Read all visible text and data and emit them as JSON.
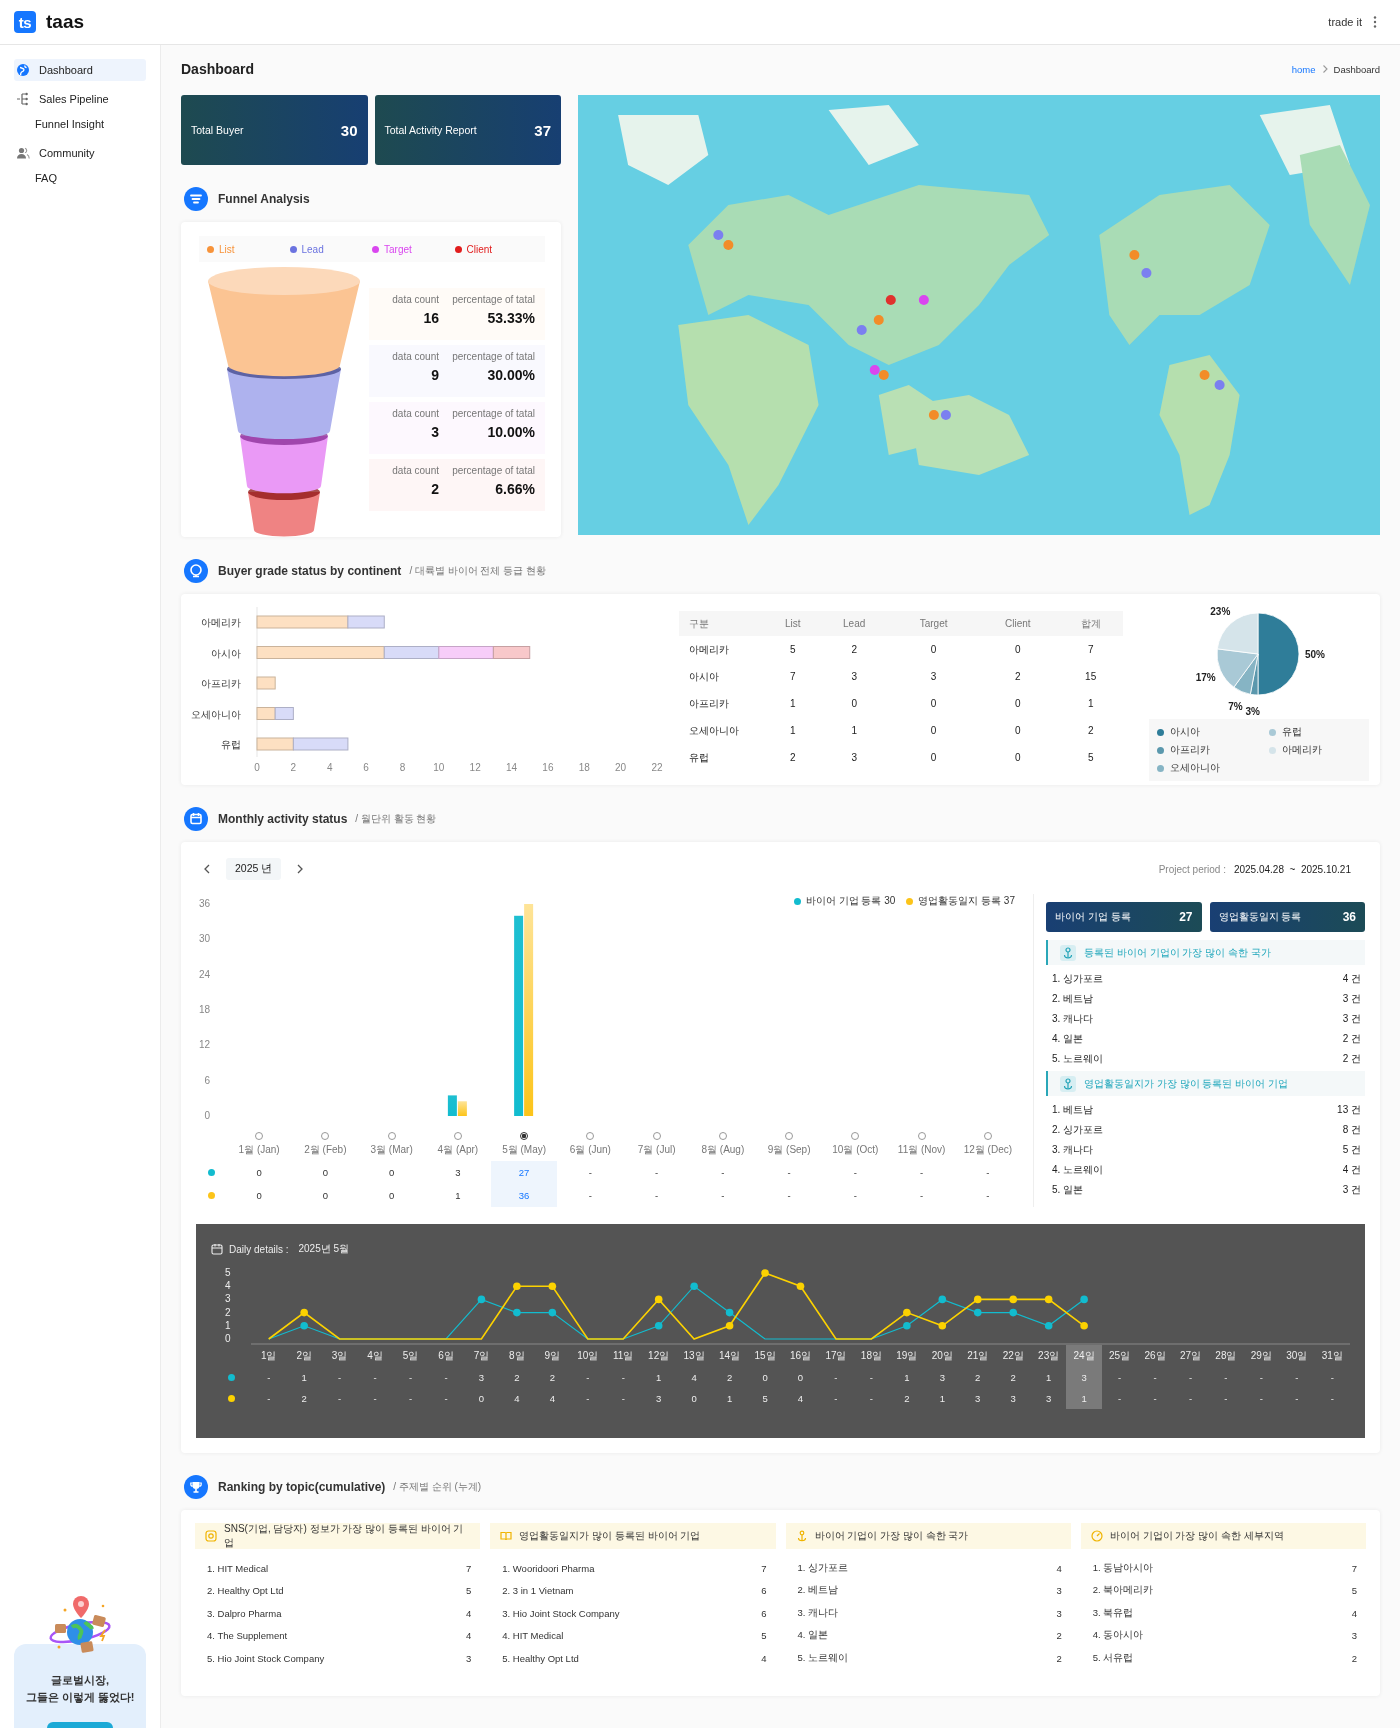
{
  "header": {
    "logo_mark": "ts",
    "brand": "taas",
    "user": "trade it"
  },
  "sidebar": {
    "items": [
      {
        "label": "Dashboard",
        "selected": true
      },
      {
        "label": "Sales Pipeline",
        "selected": false,
        "children": [
          {
            "label": "Funnel Insight",
            "selected": false
          }
        ]
      },
      {
        "label": "Community",
        "selected": false,
        "children": [
          {
            "label": "FAQ",
            "selected": false
          }
        ]
      }
    ],
    "promo": {
      "text": "글로벌시장,\n그들은 이렇게 뚫었다!"
    }
  },
  "page": {
    "title": "Dashboard",
    "breadcrumb": [
      "home",
      "Dashboard"
    ]
  },
  "stats": [
    {
      "label": "Total Buyer",
      "value": "30"
    },
    {
      "label": "Total Activity Report",
      "value": "37"
    }
  ],
  "funnel": {
    "title": "Funnel Analysis",
    "stages": [
      {
        "label": "List",
        "color": "#f7933a",
        "count_label": "data count",
        "count": "16",
        "percent_label": "percentage of tatal",
        "percent": "53.33%"
      },
      {
        "label": "Lead",
        "color": "#6b73e0",
        "count_label": "data count",
        "count": "9",
        "percent_label": "percentage of tatal",
        "percent": "30.00%"
      },
      {
        "label": "Target",
        "color": "#d946ef",
        "count_label": "data count",
        "count": "3",
        "percent_label": "percentage of tatal",
        "percent": "10.00%"
      },
      {
        "label": "Client",
        "color": "#e11d1d",
        "count_label": "data count",
        "count": "2",
        "percent_label": "percentage of tatal",
        "percent": "6.66%"
      }
    ]
  },
  "buyer_grade": {
    "title": "Buyer grade status by continent",
    "subtitle": "/ 대륙별 바이어 전체 등급 현황",
    "chart_data": {
      "type": "bar",
      "orientation": "horizontal",
      "stacked": true,
      "categories": [
        "아메리카",
        "아시아",
        "아프리카",
        "오세아니아",
        "유럽"
      ],
      "series": [
        {
          "color": "#fde0c2",
          "values": [
            5,
            7,
            1,
            1,
            2
          ]
        },
        {
          "color": "#d8dbf8",
          "values": [
            2,
            3,
            0,
            1,
            3
          ]
        },
        {
          "color": "#f7cdf9",
          "values": [
            0,
            3,
            0,
            0,
            0
          ]
        },
        {
          "color": "#f8c8ca",
          "values": [
            0,
            2,
            0,
            0,
            0
          ]
        }
      ],
      "xlim": [
        0,
        22
      ],
      "xticks": [
        0,
        2,
        4,
        6,
        8,
        10,
        12,
        14,
        16,
        18,
        20,
        22
      ]
    },
    "table": {
      "columns": [
        "구분",
        "List",
        "Lead",
        "Target",
        "Client",
        "합계"
      ],
      "rows": [
        [
          "아메리카",
          "5",
          "2",
          "0",
          "0",
          "7"
        ],
        [
          "아시아",
          "7",
          "3",
          "3",
          "2",
          "15"
        ],
        [
          "아프리카",
          "1",
          "0",
          "0",
          "0",
          "1"
        ],
        [
          "오세아니아",
          "1",
          "1",
          "0",
          "0",
          "2"
        ],
        [
          "유럽",
          "2",
          "3",
          "0",
          "0",
          "5"
        ]
      ]
    },
    "pie": {
      "chart_data": {
        "type": "pie",
        "categories": [
          "아시아",
          "아프리카",
          "오세아니아",
          "유럽",
          "아메리카"
        ],
        "values": [
          50,
          3,
          7,
          17,
          23
        ],
        "value_labels": [
          "50%",
          "3%",
          "7%",
          "17%",
          "23%"
        ]
      },
      "legend": [
        {
          "color": "#2f7d99"
        },
        {
          "color": "#5b98ad"
        },
        {
          "color": "#86b4c4"
        },
        {
          "color": "#a9c9d6"
        },
        {
          "color": "#d5e4ea"
        }
      ]
    }
  },
  "monthly": {
    "title": "Monthly activity status",
    "subtitle": "/ 월단위 활동 현황",
    "year": "2025 년",
    "period": {
      "label": "Project period :",
      "value": "2025.04.28  ~  2025.10.21"
    },
    "chart_data": {
      "type": "bar",
      "categories": [
        "1월 (Jan)",
        "2월 (Feb)",
        "3월 (Mar)",
        "4월 (Apr)",
        "5월 (May)",
        "6월 (Jun)",
        "7월 (Jul)",
        "8월 (Aug)",
        "9월 (Sep)",
        "10월 (Oct)",
        "11월 (Nov)",
        "12월 (Dec)"
      ],
      "series": [
        {
          "name": "바이어 기업 등록 30",
          "color": "#12bccf",
          "values": [
            0,
            0,
            0,
            3.5,
            34,
            null,
            null,
            null,
            null,
            null,
            null,
            null
          ]
        },
        {
          "name": "영업활동일지 등록 37",
          "color": "#fcc419",
          "values": [
            0,
            0,
            0,
            2.5,
            36,
            null,
            null,
            null,
            null,
            null,
            null,
            null
          ]
        }
      ],
      "ylim": [
        0,
        36
      ],
      "yticks": [
        0,
        6,
        12,
        18,
        24,
        30,
        36
      ],
      "legend": "upper right"
    },
    "months": [
      {
        "selected": false
      },
      {
        "selected": false
      },
      {
        "selected": false
      },
      {
        "selected": false
      },
      {
        "selected": true
      },
      {
        "selected": false
      },
      {
        "selected": false
      },
      {
        "selected": false
      },
      {
        "selected": false
      },
      {
        "selected": false
      },
      {
        "selected": false
      },
      {
        "selected": false
      }
    ],
    "table_rows": [
      [
        "0",
        "0",
        "0",
        "3",
        "27",
        "-",
        "-",
        "-",
        "-",
        "-",
        "-",
        "-"
      ],
      [
        "0",
        "0",
        "0",
        "1",
        "36",
        "-",
        "-",
        "-",
        "-",
        "-",
        "-",
        "-"
      ]
    ],
    "summary": [
      {
        "label": "바이어 기업 등록",
        "value": "27"
      },
      {
        "label": "영업활동일지 등록",
        "value": "36"
      }
    ],
    "lists": [
      {
        "title": "등록된 바이어 기업이 가장 많이 속한 국가",
        "items": [
          {
            "name": "1. 싱가포르",
            "value": "4 건"
          },
          {
            "name": "2. 베트남",
            "value": "3 건"
          },
          {
            "name": "3. 캐나다",
            "value": "3 건"
          },
          {
            "name": "4. 일본",
            "value": "2 건"
          },
          {
            "name": "5. 노르웨이",
            "value": "2 건"
          }
        ]
      },
      {
        "title": "영업활동일지가 가장 많이 등록된 바이어 기업",
        "items": [
          {
            "name": "1. 베트남",
            "value": "13 건"
          },
          {
            "name": "2. 싱가포르",
            "value": "8 건"
          },
          {
            "name": "3. 캐나다",
            "value": "5 건"
          },
          {
            "name": "4. 노르웨이",
            "value": "4 건"
          },
          {
            "name": "5. 일본",
            "value": "3 건"
          }
        ]
      }
    ],
    "daily": {
      "title": "Daily details :",
      "month": "2025년 5월",
      "chart_data": {
        "type": "line",
        "categories": [
          "1일",
          "2일",
          "3일",
          "4일",
          "5일",
          "6일",
          "7일",
          "8일",
          "9일",
          "10일",
          "11일",
          "12일",
          "13일",
          "14일",
          "15일",
          "16일",
          "17일",
          "18일",
          "19일",
          "20일",
          "21일",
          "22일",
          "23일",
          "24일",
          "25일",
          "26일",
          "27일",
          "28일",
          "29일",
          "30일",
          "31일"
        ],
        "series": [
          {
            "color": "#12bccf",
            "values": [
              0,
              1,
              0,
              0,
              0,
              0,
              3,
              2,
              2,
              0,
              0,
              1,
              4,
              2,
              0,
              0,
              0,
              0,
              1,
              3,
              2,
              2,
              1,
              3,
              null,
              null,
              null,
              null,
              null,
              null,
              null
            ]
          },
          {
            "color": "#fcd200",
            "values": [
              0,
              2,
              0,
              0,
              0,
              0,
              0,
              4,
              4,
              0,
              0,
              3,
              0,
              1,
              5,
              4,
              0,
              0,
              2,
              1,
              3,
              3,
              3,
              1,
              null,
              null,
              null,
              null,
              null,
              null,
              null
            ]
          }
        ],
        "ylim": [
          0,
          5
        ],
        "yticks": [
          0,
          1,
          2,
          3,
          4,
          5
        ]
      },
      "days": [
        {
          "selected": false
        },
        {
          "selected": false
        },
        {
          "selected": false
        },
        {
          "selected": false
        },
        {
          "selected": false
        },
        {
          "selected": false
        },
        {
          "selected": false
        },
        {
          "selected": false
        },
        {
          "selected": false
        },
        {
          "selected": false
        },
        {
          "selected": false
        },
        {
          "selected": false
        },
        {
          "selected": false
        },
        {
          "selected": false
        },
        {
          "selected": false
        },
        {
          "selected": false
        },
        {
          "selected": false
        },
        {
          "selected": false
        },
        {
          "selected": false
        },
        {
          "selected": false
        },
        {
          "selected": false
        },
        {
          "selected": false
        },
        {
          "selected": false
        },
        {
          "selected": true
        },
        {
          "selected": false
        },
        {
          "selected": false
        },
        {
          "selected": false
        },
        {
          "selected": false
        },
        {
          "selected": false
        },
        {
          "selected": false
        },
        {
          "selected": false
        }
      ],
      "rows": [
        [
          "-",
          "1",
          "-",
          "-",
          "-",
          "-",
          "3",
          "2",
          "2",
          "-",
          "-",
          "1",
          "4",
          "2",
          "0",
          "0",
          "-",
          "-",
          "1",
          "3",
          "2",
          "2",
          "1",
          "3",
          "-",
          "-",
          "-",
          "-",
          "-",
          "-",
          "-"
        ],
        [
          "-",
          "2",
          "-",
          "-",
          "-",
          "-",
          "0",
          "4",
          "4",
          "-",
          "-",
          "3",
          "0",
          "1",
          "5",
          "4",
          "-",
          "-",
          "2",
          "1",
          "3",
          "3",
          "3",
          "1",
          "-",
          "-",
          "-",
          "-",
          "-",
          "-",
          "-"
        ]
      ]
    }
  },
  "ranking": {
    "title": "Ranking by topic(cumulative)",
    "subtitle": "/ 주제별 순위 (누계)",
    "topics": [
      {
        "title": "SNS(기업, 담당자) 정보가 가장 많이 등록된 바이어 기업",
        "items": [
          {
            "name": "1. HIT Medical",
            "value": "7"
          },
          {
            "name": "2. Healthy Opt Ltd",
            "value": "5"
          },
          {
            "name": "3. Dalpro Pharma",
            "value": "4"
          },
          {
            "name": "4. The Supplement",
            "value": "4"
          },
          {
            "name": "5. Hio Joint Stock Company",
            "value": "3"
          }
        ]
      },
      {
        "title": "영업활동일지가 많이 등록된 바이어 기업",
        "items": [
          {
            "name": "1. Wooridoori Pharma",
            "value": "7"
          },
          {
            "name": "2. 3 in 1 Vietnam",
            "value": "6"
          },
          {
            "name": "3. Hio Joint Stock Company",
            "value": "6"
          },
          {
            "name": "4. HIT Medical",
            "value": "5"
          },
          {
            "name": "5. Healthy Opt Ltd",
            "value": "4"
          }
        ]
      },
      {
        "title": "바이어 기업이 가장 많이 속한 국가",
        "items": [
          {
            "name": "1. 싱가포르",
            "value": "4"
          },
          {
            "name": "2. 베트남",
            "value": "3"
          },
          {
            "name": "3. 캐나다",
            "value": "3"
          },
          {
            "name": "4. 일본",
            "value": "2"
          },
          {
            "name": "5. 노르웨이",
            "value": "2"
          }
        ]
      },
      {
        "title": "바이어 기업이 가장 많이 속한 세부지역",
        "items": [
          {
            "name": "1. 동남아시아",
            "value": "7"
          },
          {
            "name": "2. 북아메리카",
            "value": "5"
          },
          {
            "name": "3. 북유럽",
            "value": "4"
          },
          {
            "name": "4. 동아시아",
            "value": "3"
          },
          {
            "name": "5. 서유럽",
            "value": "2"
          }
        ]
      }
    ]
  }
}
